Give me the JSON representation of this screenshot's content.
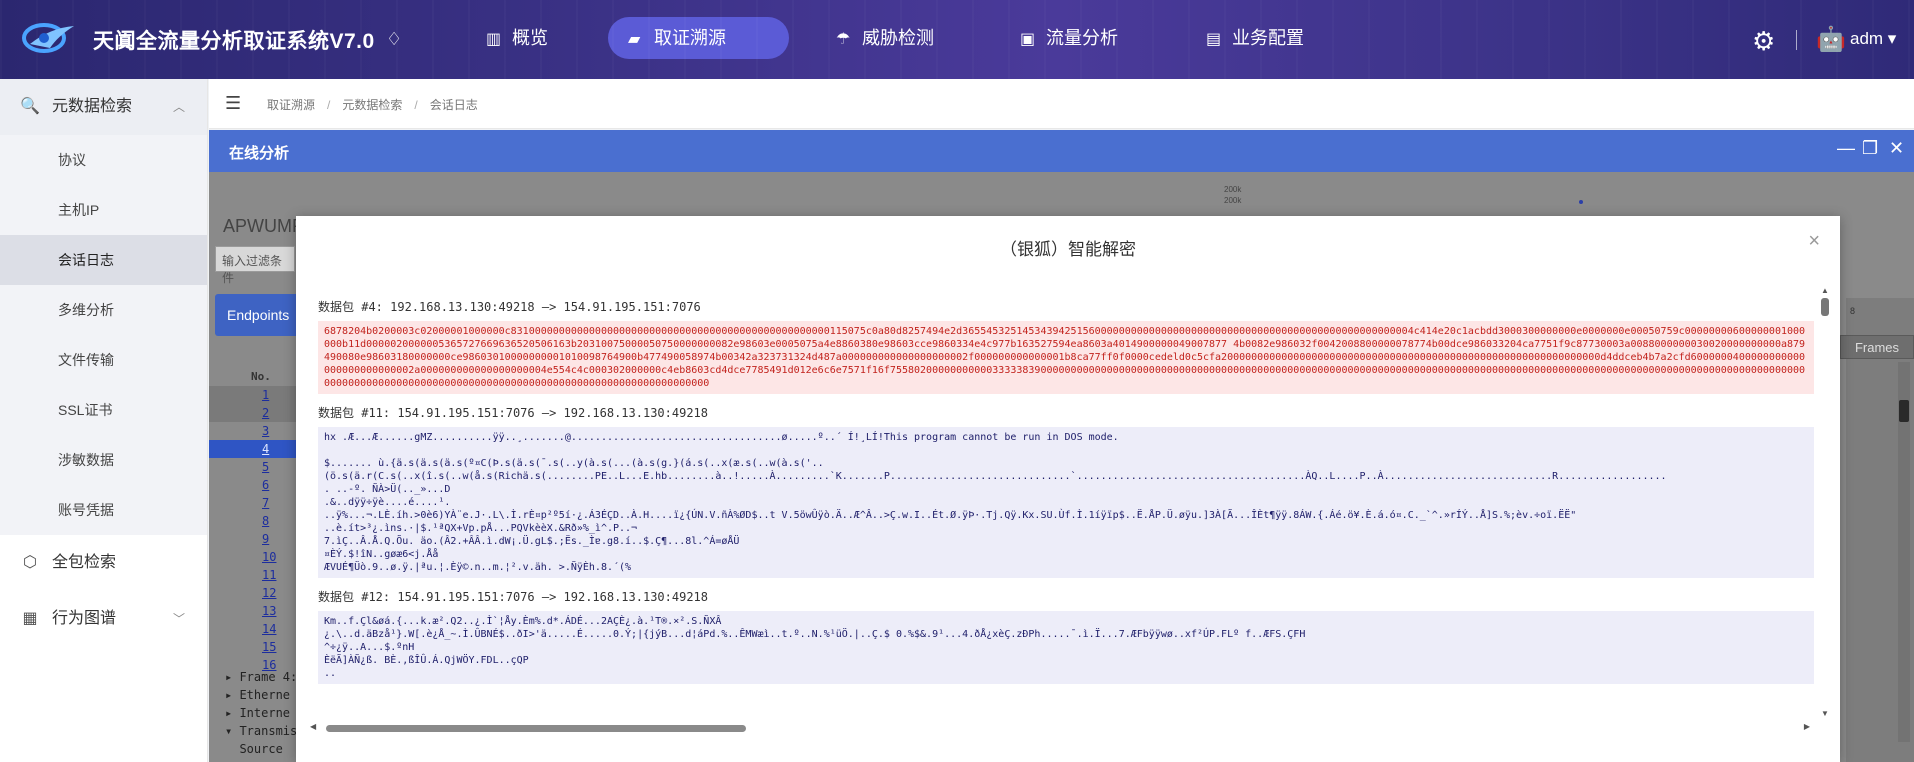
{
  "app": {
    "title": "天阗全流量分析取证系统V7.0",
    "user": "adm",
    "colors": {
      "nav_active": "#5b5bd6",
      "topbar": "#3a3185",
      "panel_header": "#4a6fd0",
      "hex_text": "#c2231d",
      "ascii_text": "#20206b"
    }
  },
  "nav": {
    "items": [
      {
        "label": "概览",
        "icon": "chart-icon"
      },
      {
        "label": "取证溯源",
        "icon": "briefcase-icon",
        "active": true
      },
      {
        "label": "威胁检测",
        "icon": "umbrella-icon"
      },
      {
        "label": "流量分析",
        "icon": "image-icon"
      },
      {
        "label": "业务配置",
        "icon": "doc-icon"
      }
    ]
  },
  "sidebar": {
    "group1": {
      "label": "元数据检索"
    },
    "subs": [
      "协议",
      "主机IP",
      "会话日志",
      "多维分析",
      "文件传输",
      "SSL证书",
      "涉敏数据",
      "账号凭据"
    ],
    "active_sub": "会话日志",
    "group2": {
      "label": "全包检索"
    },
    "group3": {
      "label": "行为图谱"
    }
  },
  "breadcrumb": [
    "取证溯源",
    "元数据检索",
    "会话日志"
  ],
  "panel": {
    "title": "在线分析"
  },
  "background": {
    "title": "APWUMP",
    "filter_placeholder": "输入过滤条件",
    "endpoints": "Endpoints",
    "frames": "Frames",
    "no_header": "No.",
    "rows": [
      "1",
      "2",
      "3",
      "4",
      "5",
      "6",
      "7",
      "8",
      "9",
      "10",
      "11",
      "12",
      "13",
      "14",
      "15",
      "16"
    ],
    "tree": [
      "Frame 4:",
      "Etherne",
      "Interne",
      "Transmis",
      "  Source"
    ],
    "ticks": [
      "200k",
      "200k"
    ],
    "axis_label": "8"
  },
  "modal": {
    "title": "（银狐）智能解密",
    "packets": [
      {
        "header": "数据包 #4: 192.168.13.130:49218 —> 154.91.195.151:7076",
        "type": "hex",
        "content": "6878204b0200003c02000001000000c83100000000000000000000000000000000000000000000000000115075c0a80d8257494e2d365545325145343942515600000000000000000000000000000000000000000000000000004c414e20c1acbdd3000300000000e0000000e00050759c00000000600000001000000b11d0000020000005365727669636520506163b20310075000050750000000082e98603e0005075a4e8860380e98603cce9860334e4c977b163527594ea8603a4014900000049007877 4b0082e986032f0042008800000078774b00dce986033204ca7751f9c87730003a0088000000030020000000000a879490080e98603180000000ce98603010000000001010098764900b477490058974b00342a323731324d487a000000000000000000002f000000000000001b8ca77ff0f0000cedeld0c5cfa200000000000000000000000000000000000000000000000000000000000000d4ddceb4b7a2cfd6000000400000000000000000000000002a000000000000000000004e554c4c000302000000c4eb8603cd4dce7785491d012e6c6e7571f16f755802000000000003333383900000000000000000000000000000000000000000000000000000000000000000000000000000000000000000000000000000000000000000000000000000000000000000000000000000000000000000000000000000000000000000000000"
      },
      {
        "header": "数据包 #11: 154.91.195.151:7076 —> 192.168.13.130:49218",
        "type": "ascii",
        "content": "hx .Æ...Æ......gMZ..........ÿÿ..¸.......@...................................ø.....º..´ Í!¸LÍ!This program cannot be run in DOS mode.\n\n$....... ù.{ä.s(ä.s(ä.s(º¤C(Þ.s(ä.s(¯.s(..y(à.s(...(à.s(g.}(á.s(..x(æ.s(..w(à.s('..\n(ö.s(ä.r(C.s(..x(î.s(..w(å.s(Richä.s(........PE..L...E.hb........à..!.....À.........`K.......P..............................`......................................ÀQ..L....P..À............................R..................\n. ..-º. ÑÀ>Ü(.._»...D\n.&..dÿÿ÷ÿè....é....¹.\n..ÿ%...¬.LÈ.íh.>0è6)YÀ¨e.J·.L\\.Ì.rÈ¤p²º5í·¿.Á3ÉÇD..À.H....ï¿{ÚN.V.ñÀ%ØD$..t V.5öwÛÿò.Ä..Æ^Â..>Ç.w.I..Ét.Ø.ÿÞ·.Tj.Qÿ.Kx.SU.Ùf.Ì.1íÿïp$..Ë.ÅP.Ü.øÿu.]3À[Ã...ÎÈt¶ÿÿ.8ÁW.{.Áé.ö¥.È.á.ó¤.C._`^.»rÍÝ..Å]S.%;èv.÷oï.ËË\"\n..è.ít>³¿.ìns.·|$.¹ªQX+Vp.pÅ...PQVkèèX.&Rð»%_ì^.P..¬\n7.ìÇ..Â.Å.Q.Õu. äo.(Â2.+ÂÂ.ì.dW¡.Ü.gL$.;Ës._Ìɐ.g8.í..$.Ç¶...8l.^Á=øÅÜ\n¤ÈÝ.$!îN..gøæ6<j.Åå\nÆVUÉ¶Üò.9..ø.ÿ.|ªu.¦.Èÿ©.n..m.¦².v.äh. >.ÑÿÈh.8.´(%"
      },
      {
        "header": "数据包 #12: 154.91.195.151:7076 —> 192.168.13.130:49218",
        "type": "ascii",
        "content": "Km..f.Çl&øá.{...k.æ².Q2..¿.Ì`¦Åy.Èm%.d*.ÁDÉ...2AÇÈ¿.à.¹T®.×².S.ÑXÂ\n¿.\\..d.äBzå¹}.W[.è¿Å_~.Ì.ÛBNÉ$..ðI>'ä.....É.....0.Ý;|{jýB...d¦áPd.%..ÊMWæì..t.º..N.%¹üÖ.|..Ç.$ 0.%$&.9¹...4.ðÅ¿xèÇ.zÐPh.....¯.ì.Ï...7.ÆFbÿÿwø..xf²ÚP.FLº f..ÆFS.ÇFH\n^÷¿ÿ..A...$.ºnH\nÈëÃ]ÀÑ¿ß. BÈ.,ßÎÛ.Á.QjWÖY.FDL..çQP\n.."
      }
    ]
  }
}
